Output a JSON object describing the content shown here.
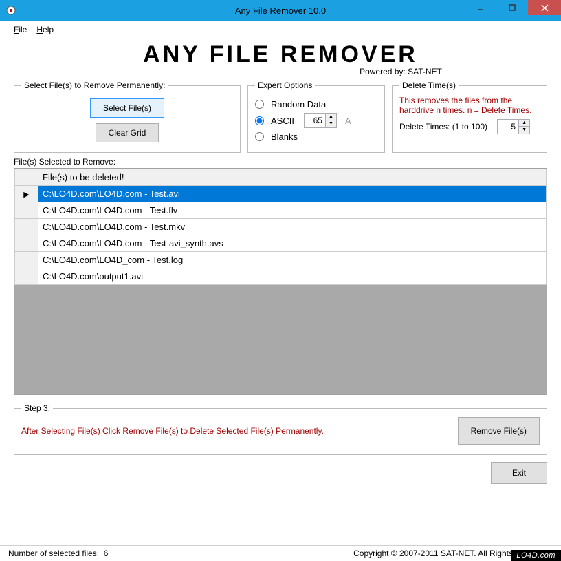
{
  "window": {
    "title": "Any File Remover 10.0"
  },
  "menu": {
    "file": "File",
    "help": "Help"
  },
  "heading": "ANY FILE REMOVER",
  "powered_by": "Powered by: SAT-NET",
  "select_group": {
    "legend": "Select File(s) to Remove Permanently:",
    "select_btn": "Select File(s)",
    "clear_btn": "Clear Grid"
  },
  "expert_group": {
    "legend": "Expert Options",
    "random": "Random Data",
    "ascii": "ASCII",
    "ascii_value": "65",
    "ascii_char": "A",
    "blanks": "Blanks",
    "selected": "ascii"
  },
  "delete_group": {
    "legend": "Delete Time(s)",
    "desc": "This removes the files from the harddrive n times. n = Delete Times.",
    "label": "Delete Times: (1 to 100)",
    "value": "5"
  },
  "grid": {
    "label": "File(s) Selected to Remove:",
    "header": "File(s) to be deleted!",
    "rows": [
      "C:\\LO4D.com\\LO4D.com - Test.avi",
      "C:\\LO4D.com\\LO4D.com - Test.flv",
      "C:\\LO4D.com\\LO4D.com - Test.mkv",
      "C:\\LO4D.com\\LO4D.com - Test-avi_synth.avs",
      "C:\\LO4D.com\\LO4D_com - Test.log",
      "C:\\LO4D.com\\output1.avi"
    ],
    "selected_index": 0
  },
  "step3": {
    "legend": "Step 3:",
    "text": "After Selecting File(s) Click Remove File(s) to Delete Selected File(s) Permanently.",
    "remove_btn": "Remove File(s)"
  },
  "exit_btn": "Exit",
  "status": {
    "left_label": "Number of selected files:",
    "count": "6",
    "copyright": "Copyright © 2007-2011 SAT-NET. All Rights Reserved."
  },
  "watermark": "LO4D.com"
}
